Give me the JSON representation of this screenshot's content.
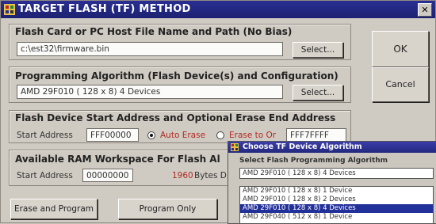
{
  "window": {
    "title": "TARGET FLASH (TF) METHOD",
    "close_glyph": "✕"
  },
  "file_group": {
    "label": "Flash Card or PC Host File Name and Path (No Bias)",
    "value": "c:\\est32\\firmware.bin",
    "select_label": "Select..."
  },
  "algo_group": {
    "label": "Programming Algorithm (Flash Device(s) and Configuration)",
    "value": "AMD    29F010  ( 128 x  8)  4 Devices",
    "select_label": "Select..."
  },
  "buttons": {
    "ok": "OK",
    "cancel": "Cancel"
  },
  "address_group": {
    "label": "Flash Device Start Address and Optional Erase End Address",
    "start_label": "Start Address",
    "start_value": "FFF00000",
    "auto_erase": "Auto Erase",
    "erase_to": "Erase to Or",
    "end_value": "FFF7FFFF"
  },
  "ram_group": {
    "label": "Available RAM Workspace For Flash Al",
    "start_label": "Start Address",
    "start_value": "00000000",
    "bytes_value": "1960",
    "bytes_label": "Bytes D"
  },
  "actions": {
    "erase_program": "Erase and Program",
    "program_only": "Program Only"
  },
  "popup": {
    "title": "Choose TF Device Algorithm",
    "label": "Select Flash Programming Algorithm",
    "selected": "AMD    29F010  ( 128 x  8)  4 Devices",
    "items": [
      "AMD    29F010  ( 128 x  8)  1 Device",
      "AMD    29F010  ( 128 x  8)  2 Devices",
      "AMD    29F010  ( 128 x  8)  4 Devices",
      "AMD    29F040  ( 512 x  8)  1 Device"
    ],
    "selected_index": 2
  },
  "colors": {
    "title_bar": "#1d2272",
    "red_text": "#b22a22",
    "selection": "#22309a"
  }
}
